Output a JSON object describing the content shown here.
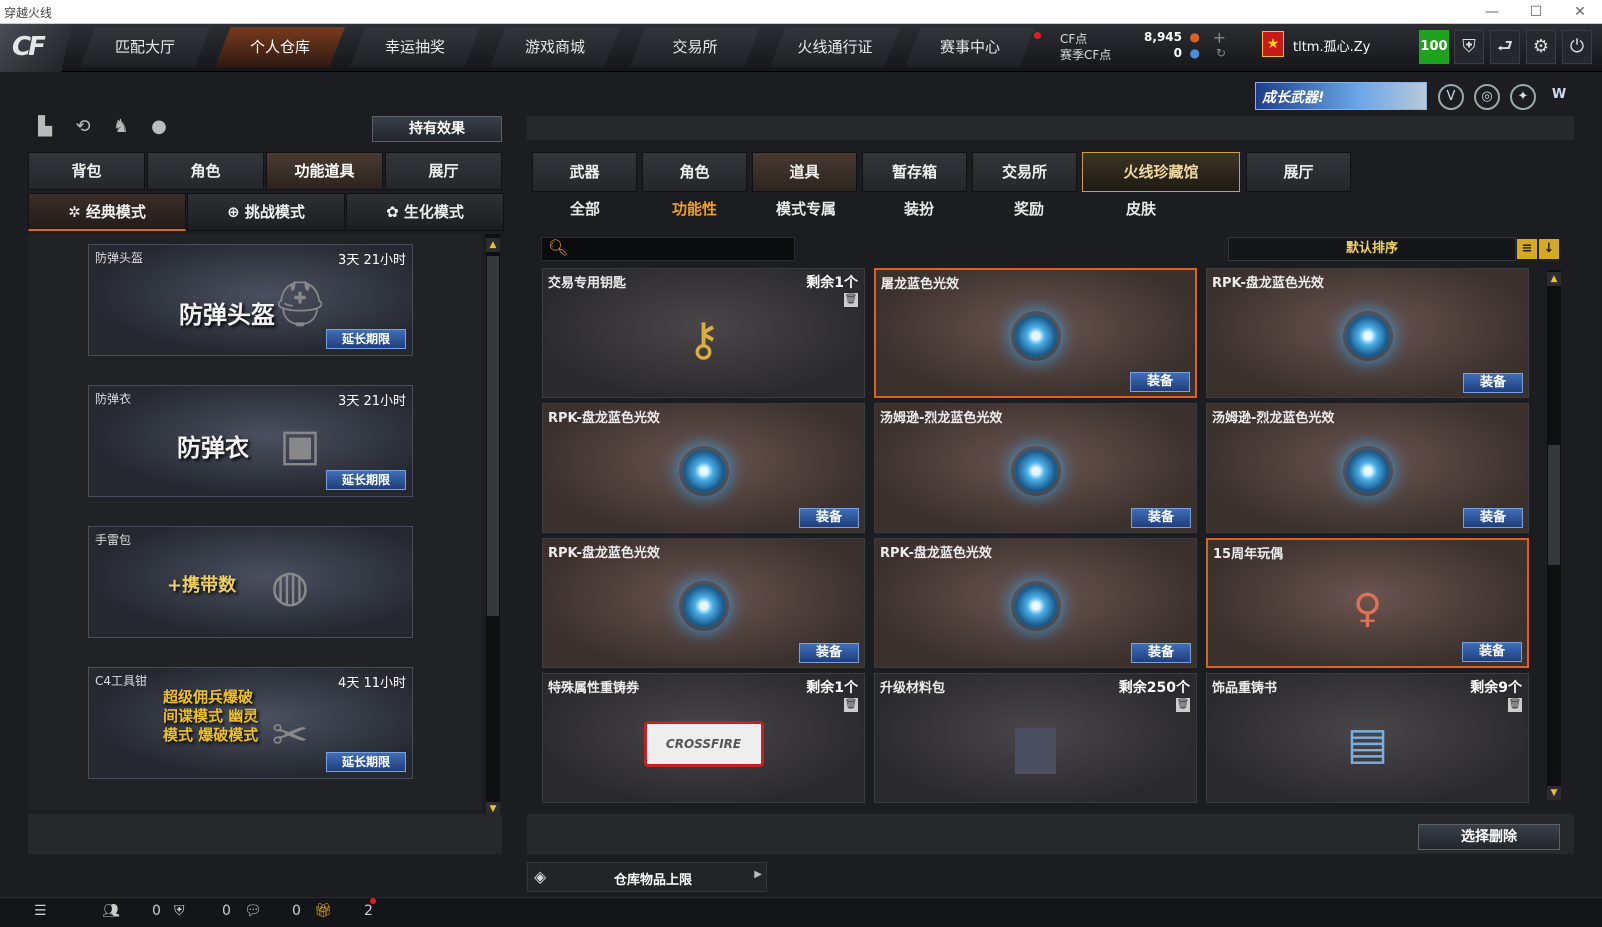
{
  "window": {
    "title": "穿越火线"
  },
  "nav": {
    "tabs": [
      "匹配大厅",
      "个人仓库",
      "幸运抽奖",
      "游戏商城",
      "交易所",
      "火线通行证",
      "赛事中心"
    ],
    "active": 1
  },
  "currency": {
    "cf_label": "CF点",
    "cf_value": "8,945",
    "season_label": "赛季CF点",
    "season_value": "0"
  },
  "user": {
    "name": "tltm.孤心.Zy",
    "level": "100"
  },
  "promo": {
    "text": "成长武器!"
  },
  "left": {
    "effect_button": "持有效果",
    "tabs": [
      "背包",
      "角色",
      "功能道具",
      "展厅"
    ],
    "active_tab": 2,
    "modes": [
      "经典模式",
      "挑战模式",
      "生化模式"
    ],
    "active_mode": 0,
    "items": [
      {
        "name": "防弹头盔",
        "time": "3天 21小时",
        "big": "防弹头盔",
        "extend": "延长期限"
      },
      {
        "name": "防弹衣",
        "time": "3天 21小时",
        "big": "防弹衣",
        "extend": "延长期限"
      },
      {
        "name": "手雷包",
        "time": "",
        "big": "+携带数",
        "extend": ""
      },
      {
        "name": "C4工具钳",
        "time": "4天 11小时",
        "big": "超级佣兵爆破 间谍模式 幽灵模式 爆破模式",
        "extend": "延长期限"
      }
    ]
  },
  "right": {
    "tabs": [
      "武器",
      "角色",
      "道具",
      "暂存箱",
      "交易所",
      "火线珍藏馆",
      "展厅"
    ],
    "active_tab": 2,
    "subtabs": [
      "全部",
      "功能性",
      "模式专属",
      "装扮",
      "奖励",
      "皮肤"
    ],
    "active_subtab": 1,
    "sort": "默认排序",
    "items": [
      {
        "name": "交易专用钥匙",
        "remain": "剩余1个",
        "equip": ""
      },
      {
        "name": "屠龙蓝色光效",
        "remain": "",
        "equip": "装备"
      },
      {
        "name": "RPK-盘龙蓝色光效",
        "remain": "",
        "equip": "装备"
      },
      {
        "name": "RPK-盘龙蓝色光效",
        "remain": "",
        "equip": "装备"
      },
      {
        "name": "汤姆逊-烈龙蓝色光效",
        "remain": "",
        "equip": "装备"
      },
      {
        "name": "汤姆逊-烈龙蓝色光效",
        "remain": "",
        "equip": "装备"
      },
      {
        "name": "RPK-盘龙蓝色光效",
        "remain": "",
        "equip": "装备"
      },
      {
        "name": "RPK-盘龙蓝色光效",
        "remain": "",
        "equip": "装备"
      },
      {
        "name": "15周年玩偶",
        "remain": "",
        "equip": "装备"
      },
      {
        "name": "特殊属性重铸券",
        "remain": "剩余1个",
        "equip": ""
      },
      {
        "name": "升级材料包",
        "remain": "剩余250个",
        "equip": ""
      },
      {
        "name": "饰品重铸书",
        "remain": "剩余9个",
        "equip": ""
      }
    ],
    "delete_button": "选择删除",
    "storage_label": "仓库物品上限"
  },
  "status": {
    "count1": "0",
    "count2": "0",
    "count3": "0",
    "count4": "2"
  }
}
